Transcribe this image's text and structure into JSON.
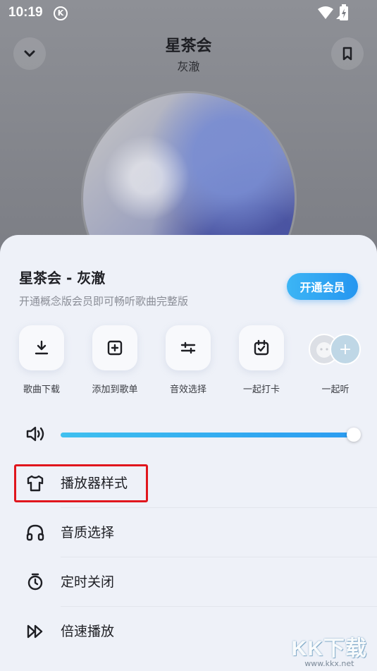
{
  "status_bar": {
    "time": "10:19",
    "k_badge": "K"
  },
  "player": {
    "title": "星茶会",
    "artist": "灰澈",
    "collapse_icon": "chevron-down-icon",
    "bookmark_icon": "bookmark-icon"
  },
  "sheet": {
    "title": "星茶会 - 灰澈",
    "subtitle": "开通概念版会员即可畅听歌曲完整版",
    "vip_button": "开通会员",
    "actions": [
      {
        "label": "歌曲下载",
        "icon": "download-icon"
      },
      {
        "label": "添加到歌单",
        "icon": "add-to-playlist-icon"
      },
      {
        "label": "音效选择",
        "icon": "equalizer-icon"
      },
      {
        "label": "一起打卡",
        "icon": "check-in-icon"
      },
      {
        "label": "一起听",
        "icon": "listen-together-icon"
      }
    ],
    "volume": {
      "level": 0.99,
      "icon": "speaker-icon"
    },
    "menu": [
      {
        "label": "播放器样式",
        "icon": "shirt-icon"
      },
      {
        "label": "音质选择",
        "icon": "headphones-icon"
      },
      {
        "label": "定时关闭",
        "icon": "timer-icon"
      },
      {
        "label": "倍速播放",
        "icon": "speed-icon"
      }
    ]
  },
  "watermark": {
    "text": "KK下载",
    "url": "www.kkx.net"
  },
  "colors": {
    "accent": "#2596f0",
    "highlight": "#e0161d",
    "sheet_bg": "#eef1f8"
  }
}
